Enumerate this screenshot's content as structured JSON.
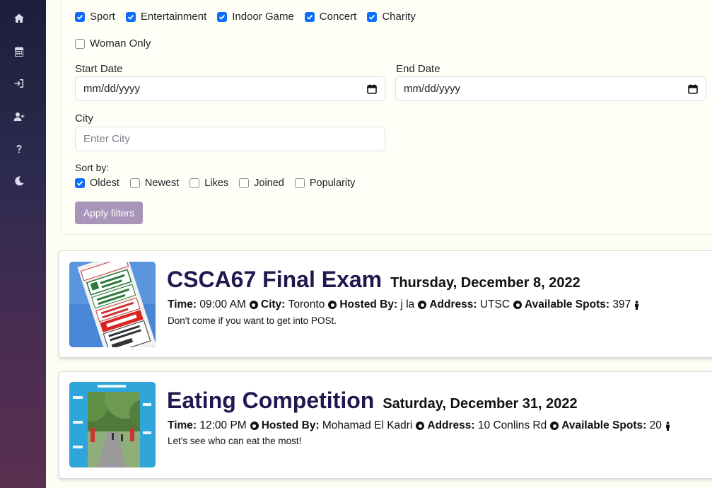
{
  "sidebar": {
    "items": [
      {
        "icon": "home-icon"
      },
      {
        "icon": "calendar-icon"
      },
      {
        "icon": "sign-in-icon"
      },
      {
        "icon": "user-plus-icon"
      },
      {
        "icon": "question-icon"
      },
      {
        "icon": "moon-icon"
      }
    ]
  },
  "filters": {
    "categories": [
      {
        "label": "Sport",
        "checked": true
      },
      {
        "label": "Entertainment",
        "checked": true
      },
      {
        "label": "Indoor Game",
        "checked": true
      },
      {
        "label": "Concert",
        "checked": true
      },
      {
        "label": "Charity",
        "checked": true
      }
    ],
    "woman_only": {
      "label": "Woman Only",
      "checked": false
    },
    "start_date": {
      "label": "Start Date",
      "placeholder": "mm/dd/yyyy"
    },
    "end_date": {
      "label": "End Date",
      "placeholder": "mm/dd/yyyy"
    },
    "city": {
      "label": "City",
      "placeholder": "Enter City"
    },
    "sort": {
      "label": "Sort by:",
      "options": [
        {
          "label": "Oldest",
          "checked": true
        },
        {
          "label": "Newest",
          "checked": false
        },
        {
          "label": "Likes",
          "checked": false
        },
        {
          "label": "Joined",
          "checked": false
        },
        {
          "label": "Popularity",
          "checked": false
        }
      ]
    },
    "apply_label": "Apply filters"
  },
  "events": [
    {
      "title": "CSCA67 Final Exam",
      "date": "Thursday, December 8, 2022",
      "time_label": "Time:",
      "time": "09:00 AM",
      "city_label": "City:",
      "city": "Toronto",
      "host_label": "Hosted By:",
      "host": "j la",
      "address_label": "Address:",
      "address": "UTSC",
      "spots_label": "Available Spots:",
      "spots": "397",
      "description": "Don't come if you want to get into POSt."
    },
    {
      "title": "Eating Competition",
      "date": "Saturday, December 31, 2022",
      "time_label": "Time:",
      "time": "12:00 PM",
      "host_label": "Hosted By:",
      "host": "Mohamad El Kadri",
      "address_label": "Address:",
      "address": "10 Conlins Rd",
      "spots_label": "Available Spots:",
      "spots": "20",
      "description": "Let's see who can eat the most!"
    }
  ]
}
